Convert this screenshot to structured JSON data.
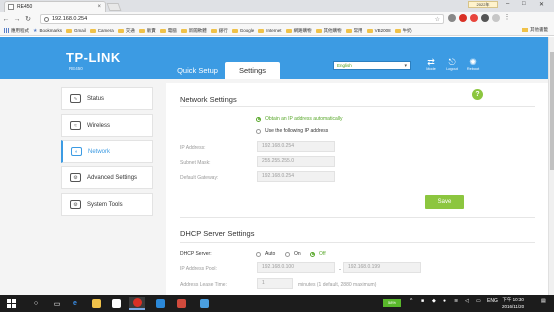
{
  "browser": {
    "tab_title": "RE450",
    "tab_close": "×",
    "user_label": "2022年",
    "url": "192.168.0.254",
    "bookmarks": [
      "應用程式",
      "Bookmarks",
      "Gmail",
      "Camera",
      "交通",
      "販賣",
      "電腦",
      "新聞軟體",
      "銀行",
      "Google",
      "Internet",
      "網路購物",
      "其他購物",
      "常用",
      "VB2008",
      "牛奶"
    ],
    "other_bookmarks": "其他書籤",
    "extension_colors": [
      "#888888",
      "#d93025",
      "#e8453c",
      "#555555",
      "#c7c7c7"
    ]
  },
  "header": {
    "logo": "TP-LINK",
    "model": "RE450",
    "tabs": {
      "quick_setup": "Quick Setup",
      "settings": "Settings"
    },
    "language": "English",
    "icons": {
      "mode": "Mode",
      "logout": "Logout",
      "reboot": "Reboot"
    },
    "accent": "#3c9be3"
  },
  "sidebar": {
    "items": [
      {
        "label": "Status",
        "icon": "status-icon",
        "glyph": "∿"
      },
      {
        "label": "Wireless",
        "icon": "wireless-icon",
        "glyph": "≈"
      },
      {
        "label": "Network",
        "icon": "network-icon",
        "glyph": "◐"
      },
      {
        "label": "Advanced Settings",
        "icon": "advanced-settings-icon",
        "glyph": "⚙"
      },
      {
        "label": "System Tools",
        "icon": "system-tools-icon",
        "glyph": "⚙"
      }
    ]
  },
  "network": {
    "title": "Network Settings",
    "opt_auto": "Obtain an IP address automatically",
    "opt_static": "Use the following IP address",
    "ip_label": "IP Address:",
    "ip_value": "192.168.0.254",
    "mask_label": "Subnet Mask:",
    "mask_value": "255.255.255.0",
    "gateway_label": "Default Gateway:",
    "gateway_value": "192.168.0.254",
    "save": "Save",
    "help": "?"
  },
  "dhcp": {
    "title": "DHCP Server Settings",
    "server_label": "DHCP Server:",
    "opt_auto": "Auto",
    "opt_on": "On",
    "opt_off": "Off",
    "pool_label": "IP Address Pool:",
    "pool_start": "192.168.0.100",
    "pool_dash": "-",
    "pool_end": "192.168.0.199",
    "lease_label": "Address Lease Time:",
    "lease_value": "1",
    "lease_note": "minutes (1 default, 2880 maximum)"
  },
  "taskbar": {
    "battery": "58%",
    "lang": "ENG",
    "time": "下午 10:30",
    "date": "2016/11/20"
  }
}
